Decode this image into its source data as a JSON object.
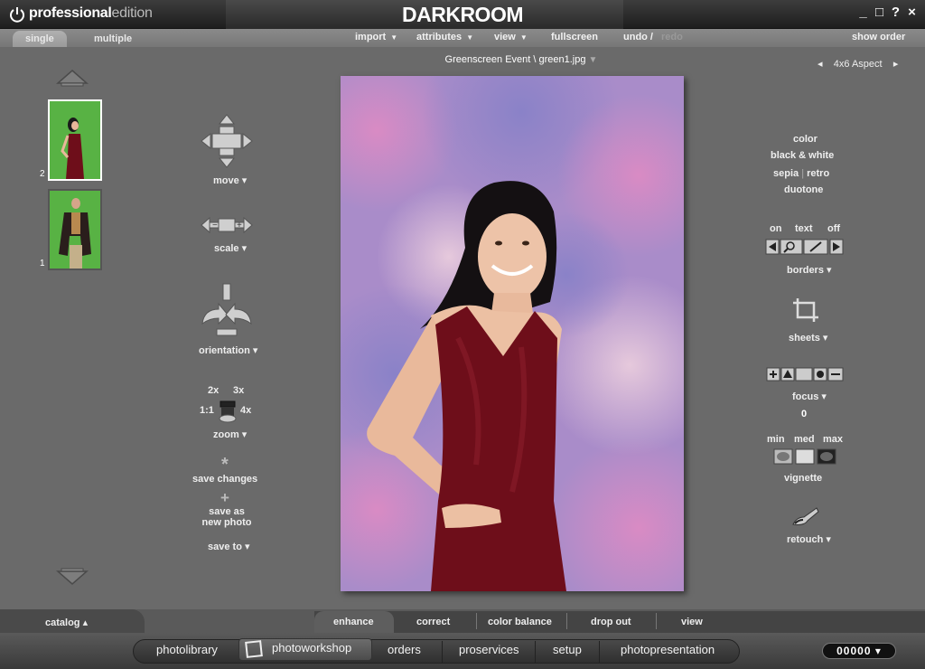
{
  "titlebar": {
    "edition_bold": "professional",
    "edition_light": "edition",
    "brand": "DARKROOM",
    "controls": [
      "_",
      "□",
      "?",
      "×"
    ]
  },
  "menubar": {
    "tabs": [
      "single",
      "multiple"
    ],
    "items": [
      {
        "label": "import",
        "dropdown": "▼"
      },
      {
        "label": "attributes",
        "dropdown": "▼"
      },
      {
        "label": "view",
        "dropdown": "▼"
      },
      {
        "label": "fullscreen"
      },
      {
        "label": "undo /"
      },
      {
        "label": "redo"
      },
      {
        "label": "show order"
      }
    ]
  },
  "filepath": {
    "text": "Greenscreen Event \\ green1.jpg",
    "dropdown": "▼"
  },
  "aspect": {
    "prev": "◂",
    "value": "4x6",
    "label": "Aspect",
    "next": "▸"
  },
  "thumbnails": [
    {
      "number": "2",
      "selected": true
    },
    {
      "number": "1",
      "selected": false
    }
  ],
  "tools": {
    "move": "move ▾",
    "scale": "scale ▾",
    "orientation": "orientation ▾",
    "zoom": {
      "z2": "2x",
      "z3": "3x",
      "z1": "1:1",
      "z4": "4x",
      "label": "zoom ▾"
    },
    "save_changes": {
      "icon": "*",
      "label": "save changes"
    },
    "save_as": {
      "icon": "+",
      "line1": "save as",
      "line2": "new photo"
    },
    "save_to": "save to ▾"
  },
  "right": {
    "color": "color",
    "bw": "black & white",
    "sepia": "sepia",
    "sep": "|",
    "retro": "retro",
    "duotone": "duotone",
    "on": "on",
    "text": "text",
    "off": "off",
    "borders": "borders ▾",
    "sheets": "sheets ▾",
    "focus": "focus ▾",
    "focus_value": "0",
    "min": "min",
    "med": "med",
    "max": "max",
    "vignette": "vignette",
    "retouch": "retouch ▾"
  },
  "bottom": {
    "catalog": "catalog ▴",
    "subtabs": [
      "enhance",
      "correct",
      "color balance",
      "drop out",
      "view"
    ],
    "dock": [
      "photolibrary",
      "photoworkshop",
      "orders",
      "proservices",
      "setup",
      "photopresentation"
    ],
    "counter": "00000 ▾"
  },
  "colors": {
    "accent_green": "#58b244",
    "dress": "#6e0e1a",
    "background": "#6a6a6a"
  }
}
